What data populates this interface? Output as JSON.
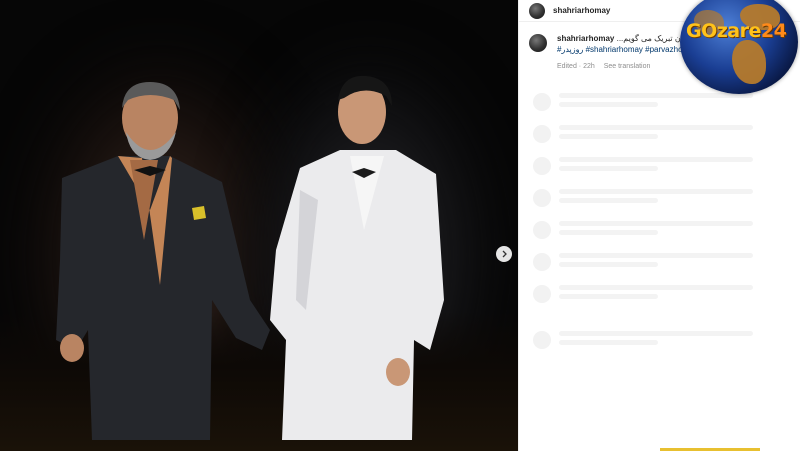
{
  "post": {
    "username": "shahriarhomay",
    "photo_description_icon": "photo-concert-icon"
  },
  "caption": {
    "username": "shahriarhomay",
    "text": "...زان تبریک می گویم",
    "hashtags": "#روزپدر #shahriarhomay #parvazhom",
    "edited": "Edited · 22h",
    "see_translation": "See translation"
  },
  "watermark": {
    "part1": "GOzare",
    "part2": "24"
  },
  "colors": {
    "link": "#00376b",
    "meta": "#8e8e8e",
    "watermark_yellow": "#ffc21a",
    "watermark_orange": "#ff8a1a"
  }
}
